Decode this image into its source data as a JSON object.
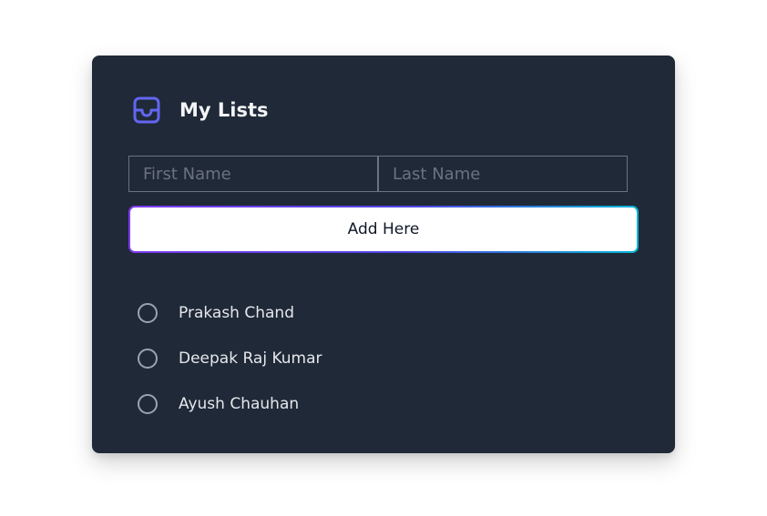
{
  "card": {
    "title": "My Lists",
    "icon": "inbox-icon",
    "accent_color": "#6366f1"
  },
  "form": {
    "first_name_placeholder": "First Name",
    "last_name_placeholder": "Last Name",
    "first_name_value": "",
    "last_name_value": "",
    "add_button_label": "Add Here"
  },
  "list": {
    "items": [
      {
        "label": "Prakash Chand",
        "checked": false
      },
      {
        "label": "Deepak Raj Kumar",
        "checked": false
      },
      {
        "label": "Ayush Chauhan",
        "checked": false
      }
    ]
  }
}
